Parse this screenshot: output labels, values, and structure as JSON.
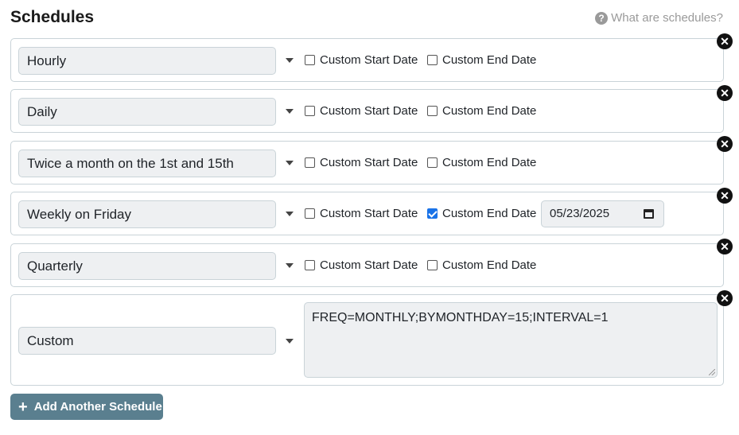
{
  "page": {
    "title": "Schedules",
    "help_link": "What are schedules?",
    "help_icon": "question-circle-icon",
    "add_button": "Add Another Schedule",
    "add_icon": "plus-icon"
  },
  "labels": {
    "custom_start": "Custom Start Date",
    "custom_end": "Custom End Date"
  },
  "schedules": [
    {
      "frequency": "Hourly",
      "custom_start": false,
      "custom_end": false
    },
    {
      "frequency": "Daily",
      "custom_start": false,
      "custom_end": false
    },
    {
      "frequency": "Twice a month on the 1st and 15th",
      "custom_start": false,
      "custom_end": false
    },
    {
      "frequency": "Weekly on Friday",
      "custom_start": false,
      "custom_end": true,
      "end_date": "05/23/2025"
    },
    {
      "frequency": "Quarterly",
      "custom_start": false,
      "custom_end": false
    },
    {
      "frequency": "Custom",
      "rrule": "FREQ=MONTHLY;BYMONTHDAY=15;INTERVAL=1"
    }
  ],
  "colors": {
    "add_button_bg": "#5a7f8f",
    "checkbox_checked": "#1a73e8",
    "input_bg": "#eef0f2",
    "row_border": "#c9d3d8"
  }
}
